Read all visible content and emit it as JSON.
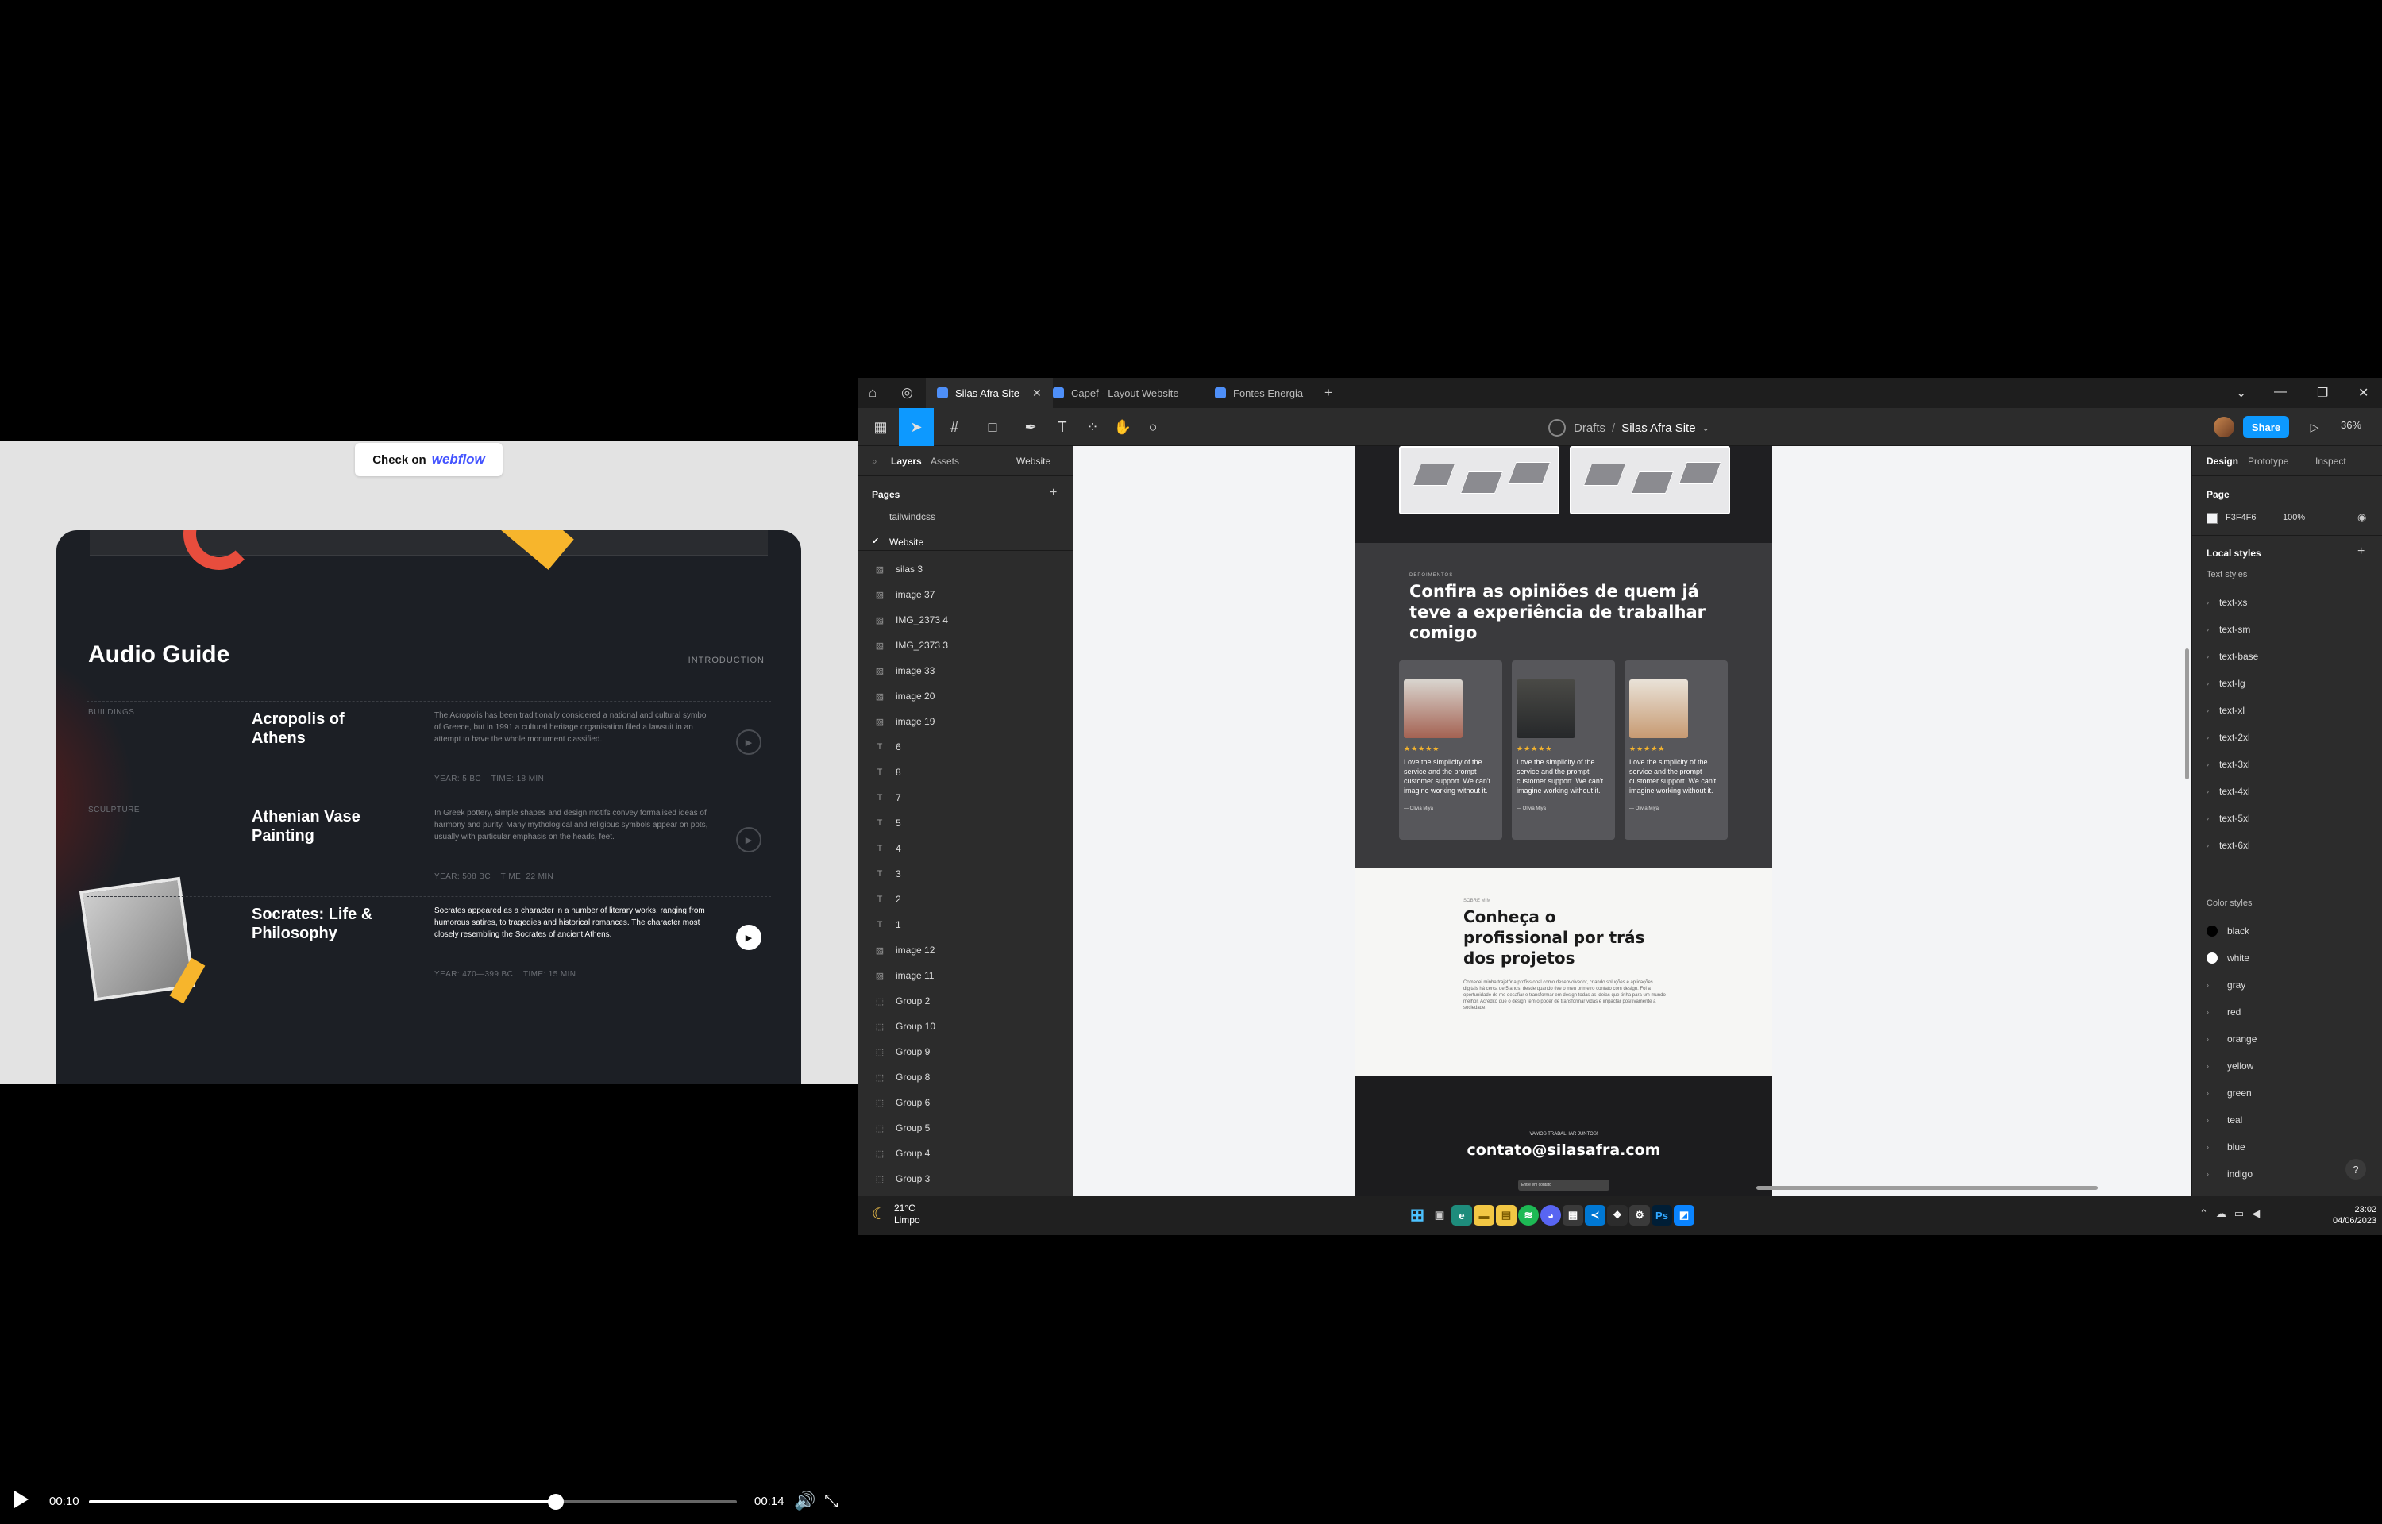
{
  "video": {
    "badge_prefix": "Check on",
    "badge_brand": "webflow",
    "audio_guide": {
      "title": "Audio Guide",
      "intro_link": "INTRODUCTION",
      "items": [
        {
          "tag": "BUILDINGS",
          "name": "Acropolis of Athens",
          "desc": "The Acropolis has been traditionally considered a national and cultural symbol of Greece, but in 1991 a cultural heritage organisation filed a lawsuit in an attempt to have the whole monument classified.",
          "year": "YEAR: 5 BC",
          "time": "TIME: 18 MIN"
        },
        {
          "tag": "SCULPTURE",
          "name": "Athenian Vase Painting",
          "desc": "In Greek pottery, simple shapes and design motifs convey formalised ideas of harmony and purity. Many mythological and religious symbols appear on pots, usually with particular emphasis on the heads, feet.",
          "year": "YEAR: 508 BC",
          "time": "TIME: 22 MIN"
        },
        {
          "tag": "",
          "name": "Socrates: Life & Philosophy",
          "desc": "Socrates appeared as a character in a number of literary works, ranging from humorous satires, to tragedies and historical romances. The character most closely resembling the Socrates of ancient Athens.",
          "year": "YEAR: 470—399 BC",
          "time": "TIME: 15 MIN"
        }
      ]
    },
    "controls": {
      "current": "00:10",
      "total": "00:14",
      "progress": 0.72
    }
  },
  "figma": {
    "tabs": [
      {
        "label": "Silas Afra Site",
        "active": true
      },
      {
        "label": "Capef - Layout Website",
        "active": false
      },
      {
        "label": "Fontes Energia",
        "active": false
      }
    ],
    "breadcrumb": {
      "folder": "Drafts",
      "separator": "/",
      "file": "Silas Afra Site"
    },
    "share_label": "Share",
    "zoom": "36%",
    "left_panel": {
      "tabs": [
        "Layers",
        "Assets",
        "Website"
      ],
      "pages_title": "Pages",
      "pages": [
        {
          "label": "tailwindcss",
          "selected": false
        },
        {
          "label": "Website",
          "selected": true
        }
      ],
      "layers": [
        {
          "icon": "image",
          "label": "silas 3"
        },
        {
          "icon": "image",
          "label": "image 37"
        },
        {
          "icon": "image",
          "label": "IMG_2373 4"
        },
        {
          "icon": "image",
          "label": "IMG_2373 3"
        },
        {
          "icon": "image",
          "label": "image 33"
        },
        {
          "icon": "image",
          "label": "image 20"
        },
        {
          "icon": "image",
          "label": "image 19"
        },
        {
          "icon": "text",
          "label": "6"
        },
        {
          "icon": "text",
          "label": "8"
        },
        {
          "icon": "text",
          "label": "7"
        },
        {
          "icon": "text",
          "label": "5"
        },
        {
          "icon": "text",
          "label": "4"
        },
        {
          "icon": "text",
          "label": "3"
        },
        {
          "icon": "text",
          "label": "2"
        },
        {
          "icon": "text",
          "label": "1"
        },
        {
          "icon": "image",
          "label": "image 12"
        },
        {
          "icon": "image",
          "label": "image 11"
        },
        {
          "icon": "group",
          "label": "Group 2"
        },
        {
          "icon": "group",
          "label": "Group 10"
        },
        {
          "icon": "group",
          "label": "Group 9"
        },
        {
          "icon": "group",
          "label": "Group 8"
        },
        {
          "icon": "group",
          "label": "Group 6"
        },
        {
          "icon": "group",
          "label": "Group 5"
        },
        {
          "icon": "group",
          "label": "Group 4"
        },
        {
          "icon": "group",
          "label": "Group 3"
        }
      ]
    },
    "canvas": {
      "testimonials": {
        "kicker": "DEPOIMENTOS",
        "heading": "Confira as opiniões de quem já teve a experiência de trabalhar comigo",
        "stars": "★★★★★",
        "quote": "Love the simplicity of the service and the prompt customer support. We can't imagine working without it.",
        "authors": [
          "— Olivia Miya",
          "— Olivia Miya",
          "— Olivia Miya"
        ]
      },
      "about": {
        "kicker": "SOBRE MIM",
        "heading": "Conheça o profissional por trás dos projetos",
        "body": "Comecei minha trajetória profissional como desenvolvedor, criando soluções e aplicações digitais há cerca de 5 anos, desde quando tive o meu primeiro contato com design. Foi a oportunidade de me desafiar e transformar em design todas as ideias que tinha para um mundo melhor. Acredito que o design tem o poder de transformar vidas e impactar positivamente a sociedade."
      },
      "contact": {
        "kicker": "VAMOS TRABALHAR JUNTOS!",
        "email": "contato@silasafra.com",
        "button": "Entre em contato"
      }
    },
    "right_panel": {
      "tabs": [
        "Design",
        "Prototype",
        "Inspect"
      ],
      "page_title": "Page",
      "page_color": "F3F4F6",
      "page_opacity": "100%",
      "local_styles": "Local styles",
      "text_styles_title": "Text styles",
      "text_styles": [
        "text-xs",
        "text-sm",
        "text-base",
        "text-lg",
        "text-xl",
        "text-2xl",
        "text-3xl",
        "text-4xl",
        "text-5xl",
        "text-6xl"
      ],
      "color_styles_title": "Color styles",
      "color_styles": [
        {
          "label": "black",
          "color": "#000000"
        },
        {
          "label": "white",
          "color": "#ffffff"
        },
        {
          "label": "gray",
          "color": ""
        },
        {
          "label": "red",
          "color": ""
        },
        {
          "label": "orange",
          "color": ""
        },
        {
          "label": "yellow",
          "color": ""
        },
        {
          "label": "green",
          "color": ""
        },
        {
          "label": "teal",
          "color": ""
        },
        {
          "label": "blue",
          "color": ""
        },
        {
          "label": "indigo",
          "color": ""
        }
      ]
    },
    "taskbar": {
      "weather_temp": "21°C",
      "weather_desc": "Limpo",
      "time": "23:02",
      "date": "04/06/2023"
    }
  }
}
